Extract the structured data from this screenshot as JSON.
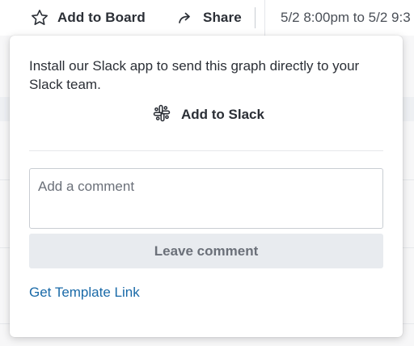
{
  "toolbar": {
    "add_to_board_label": "Add to Board",
    "add_to_board_icon": "star-icon",
    "share_label": "Share",
    "share_icon": "share-arrow-icon",
    "time_range": "5/2 8:00pm to 5/2 9:3"
  },
  "popover": {
    "install_text": "Install our Slack app to send this graph directly to your Slack team.",
    "add_to_slack_label": "Add to Slack",
    "slack_icon": "slack-icon",
    "comment_placeholder": "Add a comment",
    "comment_value": "",
    "leave_comment_label": "Leave comment",
    "template_link_label": "Get Template Link"
  },
  "colors": {
    "link": "#1a6aa8",
    "text": "#2b2f36",
    "disabled_button_bg": "#e8ebef",
    "disabled_button_text": "#6b7079"
  }
}
